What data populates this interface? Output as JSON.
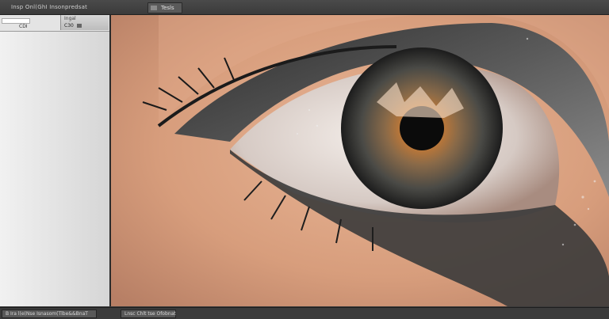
{
  "header": {
    "app_title": "Insp Onl(GhI Insonpredsat",
    "tab_label": "Tesls"
  },
  "sidebar": {
    "field_label": "CDI",
    "button_top_label": "Ingal",
    "button_bottom_label": "C30"
  },
  "canvas": {
    "image_subject": "close-up of a human eye with dark eyeshadow"
  },
  "status": {
    "left_text": "B Ira l(e(Nse Isnasom(Tlbe&&BnaT",
    "mid_text": "Lnsc Chlt tse Ofobnat"
  },
  "colors": {
    "skin": "#dca280",
    "iris_outer": "#4c4a45",
    "iris_inner": "#b0723a",
    "pupil": "#0b0b0b",
    "eyeshadow": "#3b3b3b",
    "chrome": "#3a3a3a"
  }
}
